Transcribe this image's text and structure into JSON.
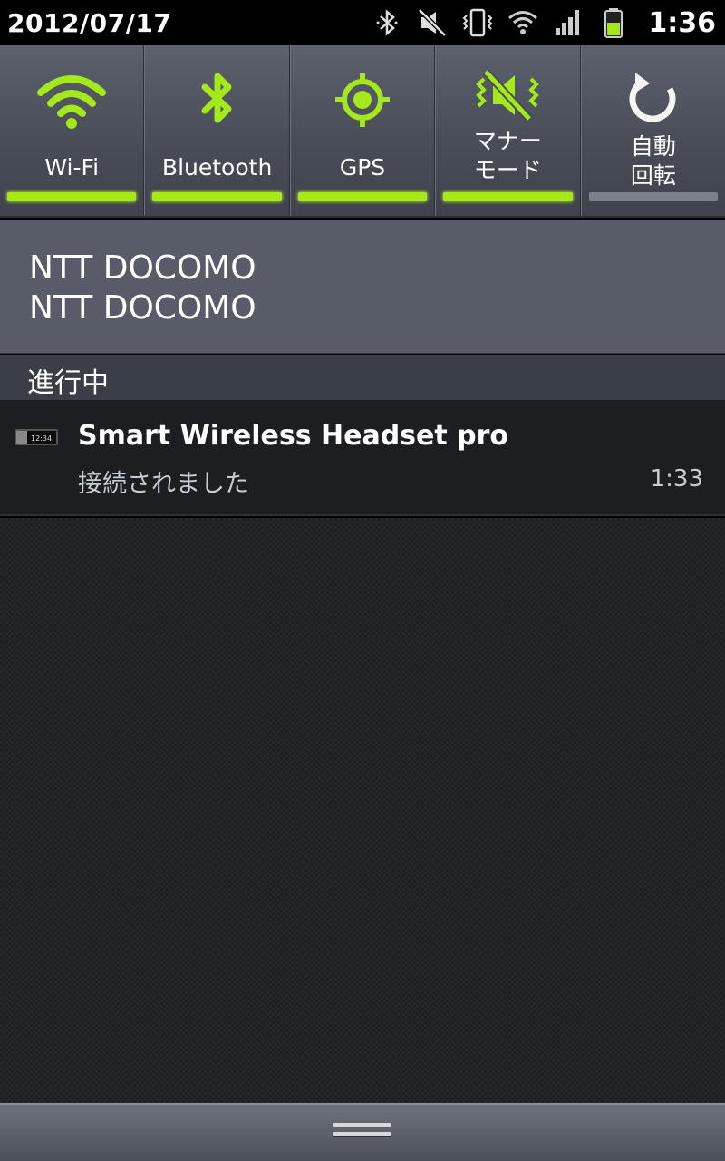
{
  "status_bar": {
    "date": "2012/07/17",
    "time": "1:36",
    "icons": [
      "bluetooth-icon",
      "silent-mode-icon",
      "vibrate-icon",
      "wifi-icon",
      "signal-icon",
      "battery-icon"
    ]
  },
  "toggles": [
    {
      "label": "Wi-Fi",
      "icon": "wifi-icon",
      "active": true
    },
    {
      "label": "Bluetooth",
      "icon": "bluetooth-icon",
      "active": true
    },
    {
      "label": "GPS",
      "icon": "gps-icon",
      "active": true
    },
    {
      "label_line1": "マナー",
      "label_line2": "モード",
      "icon": "silent-vibrate-icon",
      "active": true
    },
    {
      "label_line1": "自動",
      "label_line2": "回転",
      "icon": "rotate-icon",
      "active": false
    }
  ],
  "operator": {
    "line1": "NTT DOCOMO",
    "line2": "NTT DOCOMO"
  },
  "section": {
    "title": "進行中"
  },
  "notifications": [
    {
      "title": "Smart Wireless Headset pro",
      "text": "接続されました",
      "time": "1:33",
      "icon_text": "12:34"
    }
  ],
  "colors": {
    "accent": "#a5e81b",
    "toggle_off": "#7b808a",
    "panel": "#575c68"
  }
}
